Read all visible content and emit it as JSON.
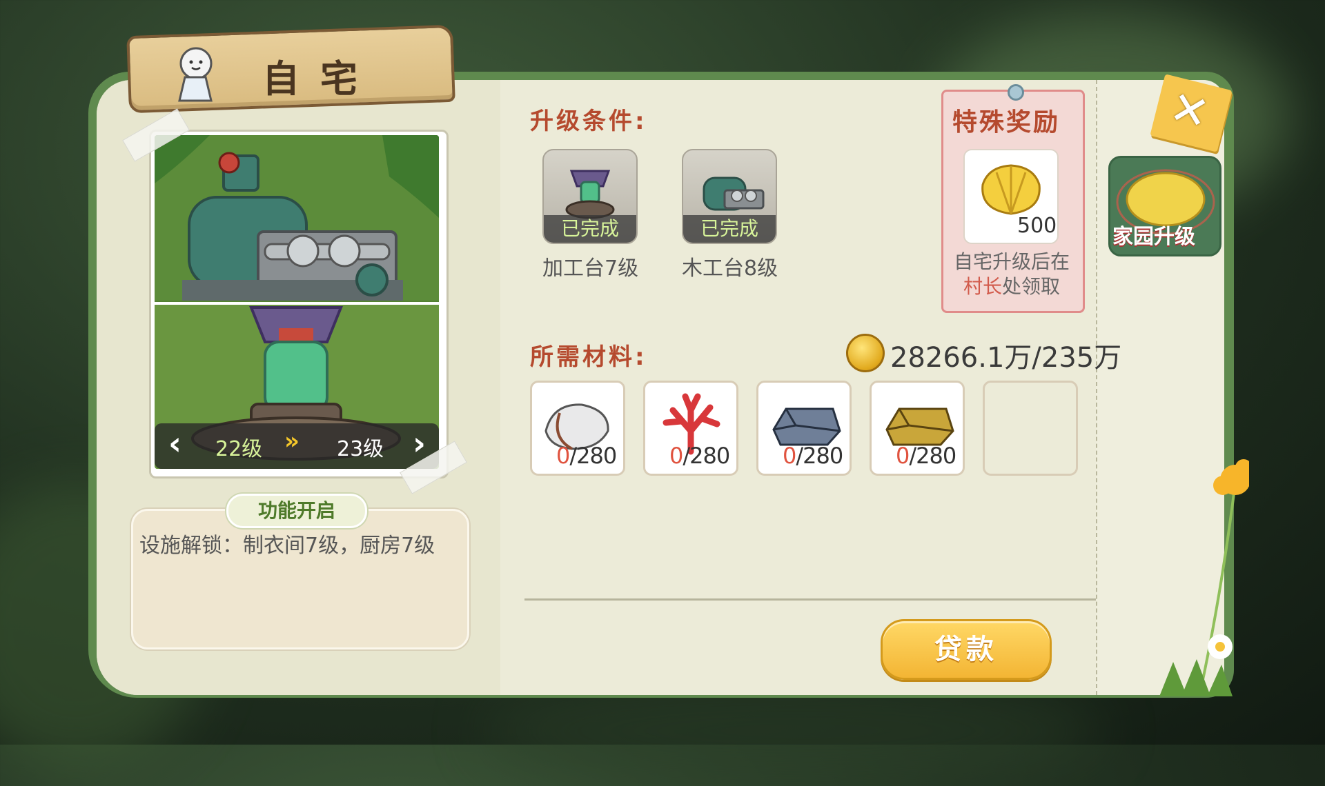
{
  "title": "自宅",
  "building": {
    "current_level": "22级",
    "next_level": "23级"
  },
  "function_unlock": {
    "tab_label": "功能开启",
    "description": "设施解锁：制衣间7级，厨房7级"
  },
  "upgrade_conditions": {
    "heading": "升级条件:",
    "items": [
      {
        "label": "加工台7级",
        "status": "已完成"
      },
      {
        "label": "木工台8级",
        "status": "已完成"
      }
    ]
  },
  "special_reward": {
    "heading": "特殊奖励",
    "item_icon": "golden-shell-icon",
    "quantity": "500",
    "note_part1": "自宅升级后在",
    "note_highlight": "村长",
    "note_part2": "处领取"
  },
  "materials": {
    "heading": "所需材料:",
    "gold_text": "28266.1万/235万",
    "items": [
      {
        "icon": "shell-icon",
        "have": "0",
        "need": "/280"
      },
      {
        "icon": "red-coral-icon",
        "have": "0",
        "need": "/280"
      },
      {
        "icon": "iron-ingot-icon",
        "have": "0",
        "need": "/280"
      },
      {
        "icon": "gold-ingot-icon",
        "have": "0",
        "need": "/280"
      }
    ]
  },
  "loan_button": "贷款",
  "home_upgrade_button": "家园升级",
  "colors": {
    "accent_red": "#b54a2e",
    "panel_green": "#5f8a4e",
    "button_yellow": "#f3b534",
    "completed_green": "#d8f49a"
  }
}
